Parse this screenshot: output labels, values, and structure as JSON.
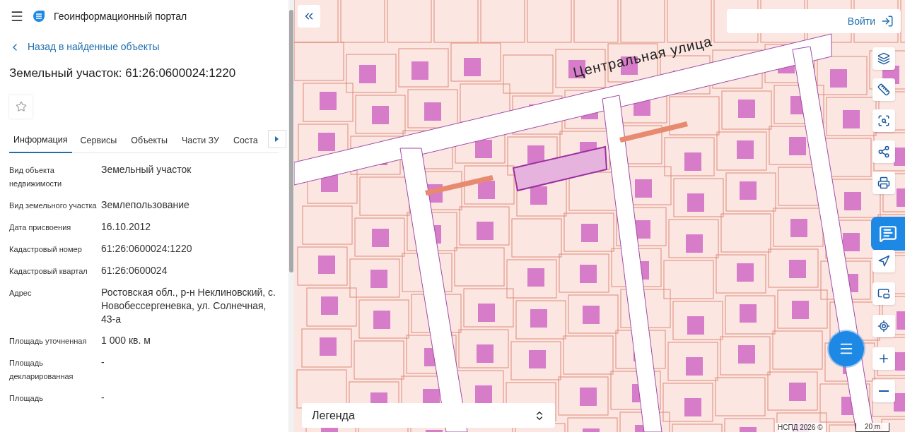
{
  "header": {
    "title": "Геоинформационный портал"
  },
  "back_link": {
    "label": "Назад в найденные объекты"
  },
  "heading": "Земельный участок: 61:26:0600024:1220",
  "favorite": {
    "selected": false
  },
  "tabs": [
    {
      "label": "Информация",
      "selected": true
    },
    {
      "label": "Сервисы",
      "selected": false
    },
    {
      "label": "Объекты",
      "selected": false
    },
    {
      "label": "Части ЗУ",
      "selected": false
    },
    {
      "label": "Соста",
      "selected": false
    }
  ],
  "fields": [
    {
      "label": "Вид объекта недвижимости",
      "value": "Земельный участок"
    },
    {
      "label": "Вид земельного участка",
      "value": "Землепользование"
    },
    {
      "label": "Дата присвоения",
      "value": "16.10.2012"
    },
    {
      "label": "Кадастровый номер",
      "value": "61:26:0600024:1220"
    },
    {
      "label": "Кадастровый квартал",
      "value": "61:26:0600024"
    },
    {
      "label": "Адрес",
      "value": "Ростовская обл., р-н Неклиновский, с. Новобессергеневка, ул. Солнечная, 43-а"
    },
    {
      "label": "Площадь уточненная",
      "value": "1 000 кв. м"
    },
    {
      "label": "Площадь декларированная",
      "value": "-"
    },
    {
      "label": "Площадь",
      "value": "-"
    }
  ],
  "map": {
    "street_label": "Центральная улица",
    "login_button": "Войти",
    "legend": "Легенда",
    "attribution": "НСПД 2026 ©",
    "scale": "20 m"
  }
}
